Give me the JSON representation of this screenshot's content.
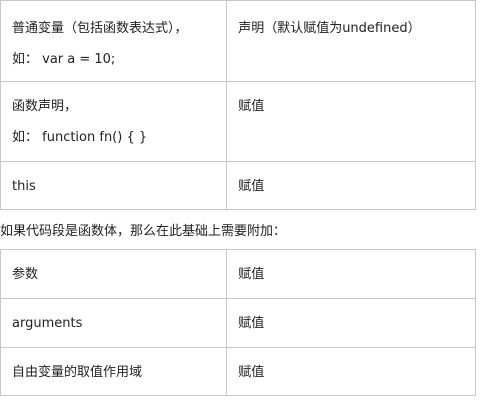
{
  "table1": {
    "rows": [
      {
        "left_line1": "普通变量（包括函数表达式），",
        "left_line2": "如： var a = 10;",
        "right": "声明（默认赋值为undefined）"
      },
      {
        "left_line1": "函数声明，",
        "left_line2": "如： function fn() { }",
        "right": "赋值"
      },
      {
        "left_line1": "this",
        "right": "赋值"
      }
    ]
  },
  "middle_text": "如果代码段是函数体，那么在此基础上需要附加：",
  "table2": {
    "rows": [
      {
        "left": "参数",
        "right": "赋值"
      },
      {
        "left": "arguments",
        "right": "赋值"
      },
      {
        "left": "自由变量的取值作用域",
        "right": "赋值"
      }
    ]
  },
  "colors": {
    "border": "#c8c8c8",
    "text": "#222222",
    "background": "#ffffff"
  }
}
